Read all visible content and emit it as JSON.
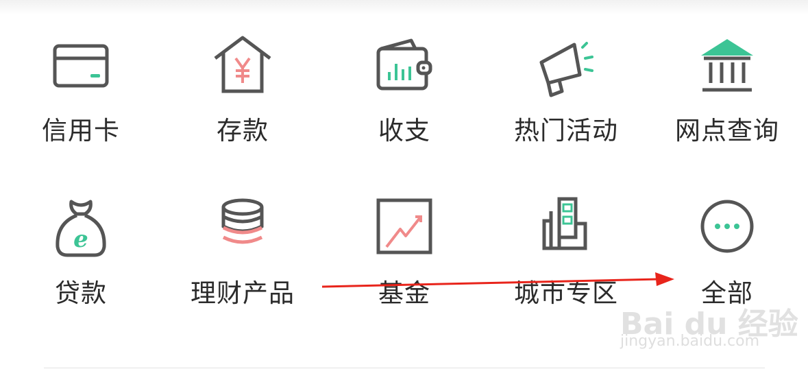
{
  "colors": {
    "icon_stroke": "#555555",
    "accent_green": "#3cc495",
    "accent_red": "#f08a8a",
    "arrow_red": "#e8241b",
    "label_text": "#2b2b2b"
  },
  "menu": {
    "items": [
      {
        "label": "信用卡",
        "icon": "credit-card-icon"
      },
      {
        "label": "存款",
        "icon": "deposit-house-icon"
      },
      {
        "label": "收支",
        "icon": "wallet-chart-icon"
      },
      {
        "label": "热门活动",
        "icon": "megaphone-icon"
      },
      {
        "label": "网点查询",
        "icon": "bank-branch-icon"
      },
      {
        "label": "贷款",
        "icon": "money-bag-icon"
      },
      {
        "label": "理财产品",
        "icon": "coin-stack-icon"
      },
      {
        "label": "基金",
        "icon": "trend-chart-icon"
      },
      {
        "label": "城市专区",
        "icon": "city-buildings-icon"
      },
      {
        "label": "全部",
        "icon": "more-icon"
      }
    ]
  },
  "watermark": {
    "logo": "Bai du 经验",
    "url": "jingyan.baidu.com"
  }
}
